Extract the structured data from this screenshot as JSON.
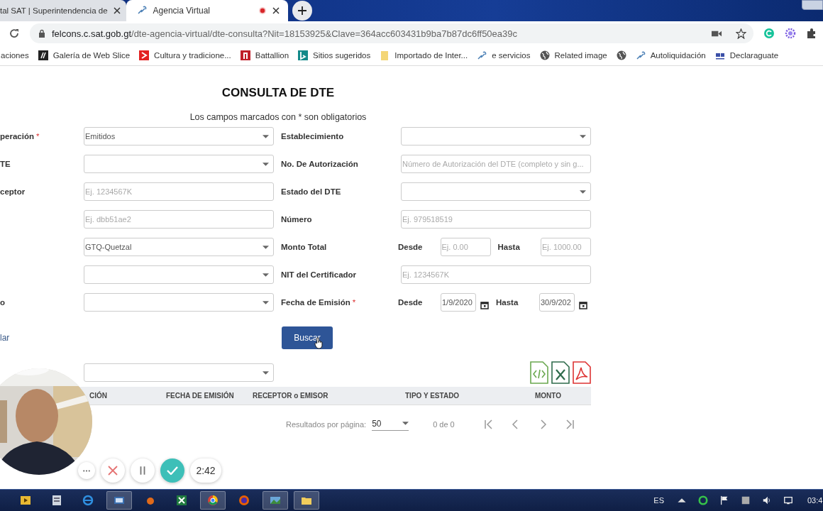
{
  "browser": {
    "tabs": [
      {
        "title": "tal SAT | Superintendencia de",
        "selected": false,
        "recording": false
      },
      {
        "title": "Agencia Virtual",
        "selected": true,
        "recording": true
      }
    ],
    "url_host": "felcons.c.sat.gob.gt",
    "url_path": "/dte-agencia-virtual/dte-consulta?Nit=18153925&Clave=364acc603431b9ba7b87dc6ff50ea39c",
    "bookmarks": [
      {
        "kind": "none",
        "label": "aciones"
      },
      {
        "kind": "slice",
        "label": "Galería de Web Slice"
      },
      {
        "kind": "red-arrow",
        "label": "Cultura y tradicione..."
      },
      {
        "kind": "red-page",
        "label": "Battallion"
      },
      {
        "kind": "bing",
        "label": "Sitios sugeridos"
      },
      {
        "kind": "folder",
        "label": "Importado de Inter..."
      },
      {
        "kind": "link",
        "label": "e servicios"
      },
      {
        "kind": "globe",
        "label": "Related image"
      },
      {
        "kind": "globe"
      },
      {
        "kind": "link",
        "label": "Autoliquidación"
      },
      {
        "kind": "dg",
        "label": "Declaraguate"
      }
    ]
  },
  "page": {
    "title": "CONSULTA DE DTE",
    "note": "Los campos marcados con * son obligatorios",
    "rows": [
      {
        "left": {
          "label": "peración",
          "required_mark": "*",
          "kind": "select",
          "value": "Emitidos"
        },
        "right": {
          "label": "Establecimiento",
          "kind": "select"
        }
      },
      {
        "left": {
          "label": "TE",
          "kind": "select"
        },
        "right": {
          "label": "No. De Autorización",
          "kind": "input",
          "placeholder": "Número de Autorización del DTE (completo y sin g..."
        }
      },
      {
        "left": {
          "label": "ceptor",
          "kind": "input",
          "placeholder": "Ej. 1234567K"
        },
        "right": {
          "label": "Estado del DTE",
          "kind": "select"
        }
      },
      {
        "left": {
          "kind": "input",
          "placeholder": "Ej. dbb51ae2"
        },
        "right": {
          "label": "Número",
          "kind": "input",
          "placeholder": "Ej. 979518519"
        }
      },
      {
        "left": {
          "kind": "select",
          "value": "GTQ-Quetzal"
        },
        "right": {
          "label": "Monto Total",
          "kind": "range",
          "from_label": "Desde",
          "from_placeholder": "Ej. 0.00",
          "to_label": "Hasta",
          "to_placeholder": "Ej. 1000.00"
        }
      },
      {
        "left": {
          "kind": "select"
        },
        "right": {
          "label": "NIT del Certificador",
          "kind": "input",
          "placeholder": "Ej. 1234567K"
        }
      },
      {
        "left": {
          "label": "o",
          "kind": "select"
        },
        "right": {
          "label": "Fecha de Emisión",
          "required_mark": "*",
          "kind": "date",
          "from_label": "Desde",
          "from_value": "1/9/2020",
          "to_label": "Hasta",
          "to_value": "30/9/202"
        }
      }
    ],
    "clear_link": "lar",
    "search_button": "Buscar",
    "columns": [
      "CIÓN",
      "FECHA DE EMISIÓN",
      "RECEPTOR o EMISOR",
      "TIPO Y ESTADO",
      "MONTO"
    ],
    "pagination": {
      "label": "Resultados por página:",
      "per_page": "50",
      "count": "0 de 0"
    }
  },
  "recorder": {
    "time": "2:42"
  },
  "taskbar": {
    "language": "ES",
    "clock": "03:4"
  }
}
